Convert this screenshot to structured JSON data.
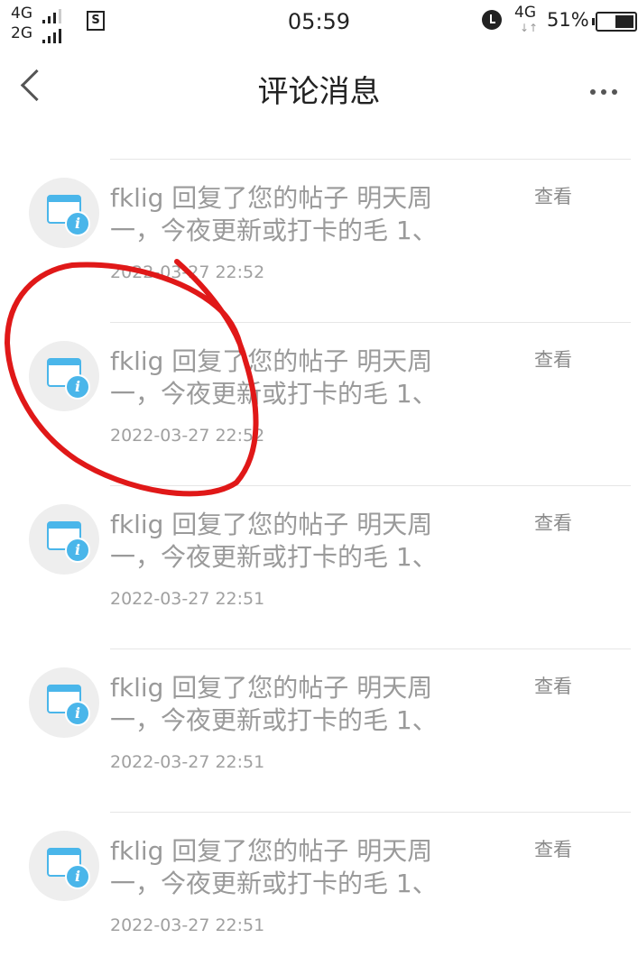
{
  "status_bar": {
    "signal_1": "4G",
    "signal_2": "2G",
    "sim_icon": "S",
    "time": "05:59",
    "network": "4G",
    "battery_percent": "51%"
  },
  "nav": {
    "title": "评论消息"
  },
  "messages": [
    {
      "text": "fklig 回复了您的帖子 明天周一，今夜更新或打卡的毛 1、",
      "time": "2022-03-27 22:52",
      "action": "查看"
    },
    {
      "text": "fklig 回复了您的帖子 明天周一，今夜更新或打卡的毛 1、",
      "time": "2022-03-27 22:52",
      "action": "查看"
    },
    {
      "text": "fklig 回复了您的帖子 明天周一，今夜更新或打卡的毛 1、",
      "time": "2022-03-27 22:51",
      "action": "查看"
    },
    {
      "text": "fklig 回复了您的帖子 明天周一，今夜更新或打卡的毛 1、",
      "time": "2022-03-27 22:51",
      "action": "查看"
    },
    {
      "text": "fklig 回复了您的帖子 明天周一，今夜更新或打卡的毛 1、",
      "time": "2022-03-27 22:51",
      "action": "查看"
    }
  ],
  "icons": {
    "back": "back-chevron-icon",
    "more": "more-dots-icon",
    "avatar": "info-card-icon"
  },
  "colors": {
    "accent": "#4ab6ea",
    "annotation": "#e01818"
  }
}
